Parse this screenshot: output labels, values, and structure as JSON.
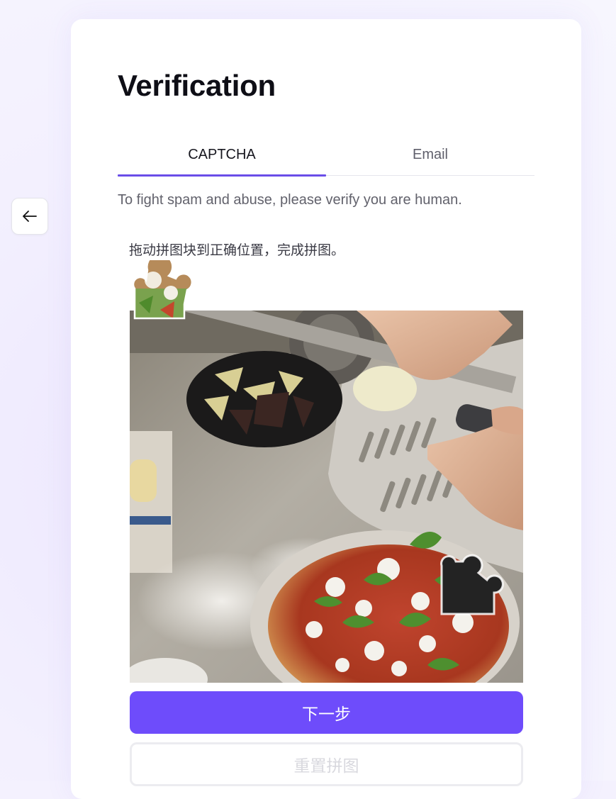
{
  "nav": {
    "back_icon": "arrow-left-icon"
  },
  "page": {
    "title": "Verification"
  },
  "tabs": [
    {
      "label": "CAPTCHA",
      "active": true
    },
    {
      "label": "Email",
      "active": false
    }
  ],
  "description": "To fight spam and abuse, please verify you are human.",
  "captcha": {
    "instruction": "拖动拼图块到正确位置，完成拼图。",
    "image_subject": "pizza-kitchen-photo",
    "piece_icon": "puzzle-piece-icon",
    "slot_icon": "puzzle-slot-icon"
  },
  "buttons": {
    "next_label": "下一步",
    "reset_label": "重置拼图"
  },
  "colors": {
    "accent": "#6e4cfb",
    "tab_underline": "#6a4ee8",
    "background": "#f4f1fe"
  }
}
